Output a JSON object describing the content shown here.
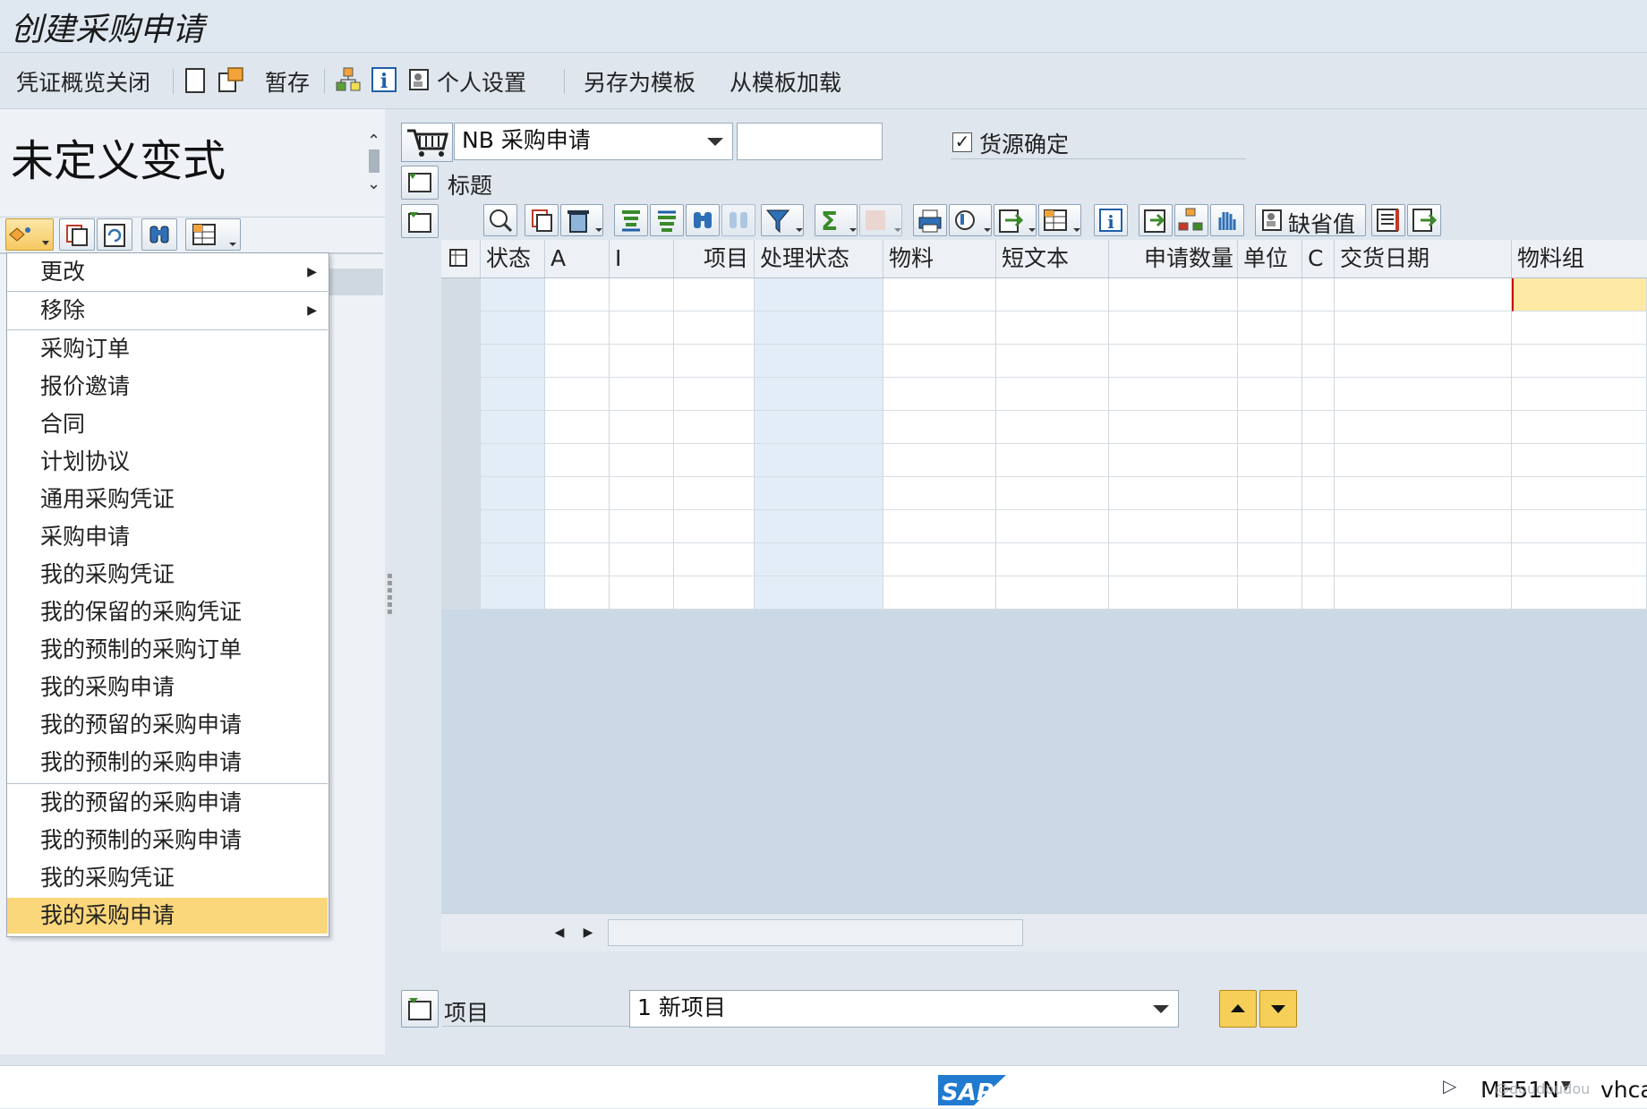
{
  "window": {
    "title": "创建采购申请"
  },
  "toolbar": {
    "overview_close": "凭证概览关闭",
    "hold": "暂存",
    "personal_settings": "个人设置",
    "save_as_template": "另存为模板",
    "load_from_template": "从模板加载"
  },
  "left_panel": {
    "variant_title": "未定义变式",
    "menu_items": [
      {
        "label": "更改",
        "submenu": true
      },
      {
        "label": "移除",
        "submenu": true
      },
      {
        "label": "采购订单"
      },
      {
        "label": "报价邀请"
      },
      {
        "label": "合同"
      },
      {
        "label": "计划协议"
      },
      {
        "label": "通用采购凭证"
      },
      {
        "label": "采购申请"
      },
      {
        "label": "我的采购凭证"
      },
      {
        "label": "我的保留的采购凭证"
      },
      {
        "label": "我的预制的采购订单"
      },
      {
        "label": "我的采购申请"
      },
      {
        "label": "我的预留的采购申请"
      },
      {
        "label": "我的预制的采购申请"
      },
      {
        "label": "我的预留的采购申请"
      },
      {
        "label": "我的预制的采购申请"
      },
      {
        "label": "我的采购凭证"
      },
      {
        "label": "我的采购申请",
        "selected": true
      }
    ]
  },
  "doc_header": {
    "doc_type": "NB 采购申请",
    "doc_number": "",
    "source_determination_label": "货源确定",
    "source_determination_checked": true,
    "header_label": "标题"
  },
  "grid": {
    "default_values_button": "缺省值",
    "columns": [
      "状态",
      "A",
      "I",
      "项目",
      "处理状态",
      "物料",
      "短文本",
      "申请数量",
      "单位",
      "C",
      "交货日期",
      "物料组"
    ],
    "row_count": 10
  },
  "item_section": {
    "label": "项目",
    "selected_item": "1 新项目"
  },
  "status_bar": {
    "brand": "SAP",
    "tcode": "ME51N",
    "system": "vhca",
    "watermark": "@doudoudou"
  }
}
